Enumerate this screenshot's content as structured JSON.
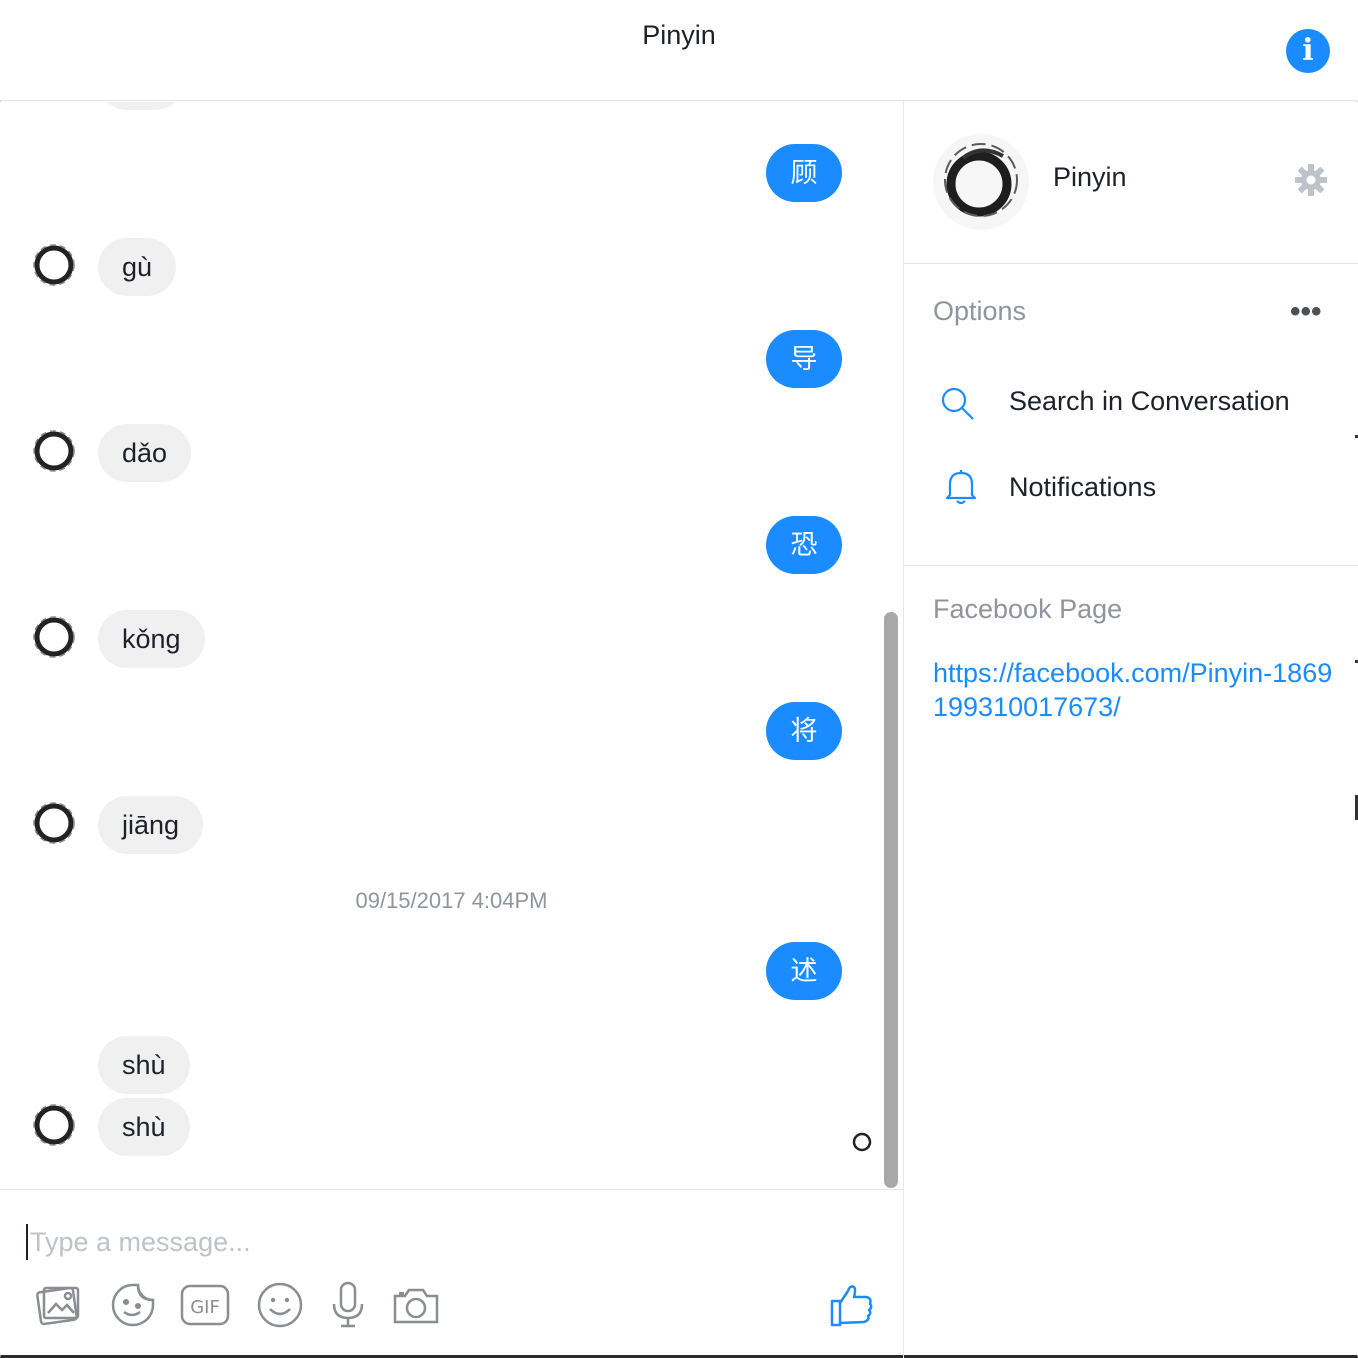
{
  "header": {
    "title": "Pinyin",
    "info_label": "i"
  },
  "messages": {
    "out_1": "顾",
    "in_1": "gù",
    "out_2": "导",
    "in_2": "dǎo",
    "out_3": "恐",
    "in_3": "kǒng",
    "out_4": "将",
    "in_4": "jiāng",
    "timestamp": "09/15/2017 4:04PM",
    "out_5": "述",
    "in_5a": "shù",
    "in_5b": "shù"
  },
  "composer": {
    "placeholder": "Type a message...",
    "tools": [
      "photo-icon",
      "sticker-icon",
      "gif-icon",
      "emoji-icon",
      "microphone-icon",
      "camera-icon"
    ],
    "gif_label": "GIF"
  },
  "panel": {
    "name": "Pinyin",
    "options_title": "Options",
    "options": {
      "search": "Search in Conversation",
      "notifications": "Notifications"
    },
    "facebook_title": "Facebook Page",
    "facebook_url": "https://facebook.com/Pinyin-1869199310017673/"
  },
  "colors": {
    "accent": "#1a8cff",
    "incoming_bubble": "#f1f0f0",
    "muted_text": "#90949c"
  }
}
